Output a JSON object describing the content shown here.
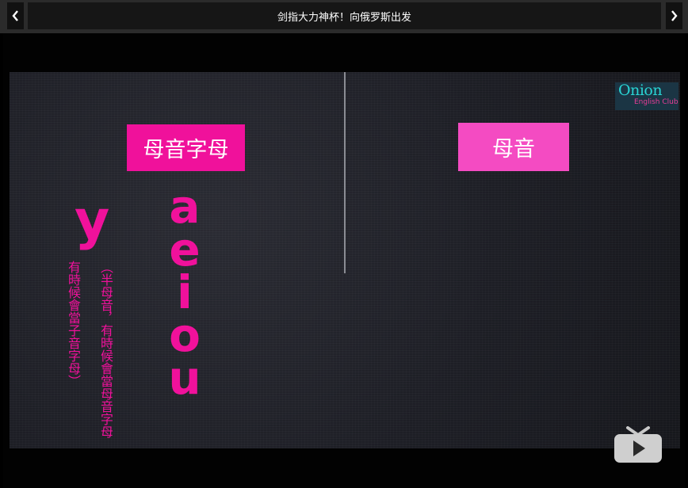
{
  "header": {
    "title": "剑指大力神杯！向俄罗斯出发",
    "prev_icon": "chevron-left-icon",
    "next_icon": "chevron-right-icon"
  },
  "video": {
    "left_box_label": "母音字母",
    "right_box_label": "母音",
    "logo": {
      "main": "Onion",
      "sub": "English Club"
    },
    "vowels": [
      "a",
      "e",
      "i",
      "o",
      "u"
    ],
    "y_letter": "y",
    "y_note_col1": "（半母音，有時候會當母音字母",
    "y_note_col2": "有時候會當子音字母）",
    "colors": {
      "pink": "#f0119b",
      "light_pink": "#f44bc2",
      "logo_teal": "#29d3d3"
    },
    "play_icon": "tv-play-icon"
  }
}
